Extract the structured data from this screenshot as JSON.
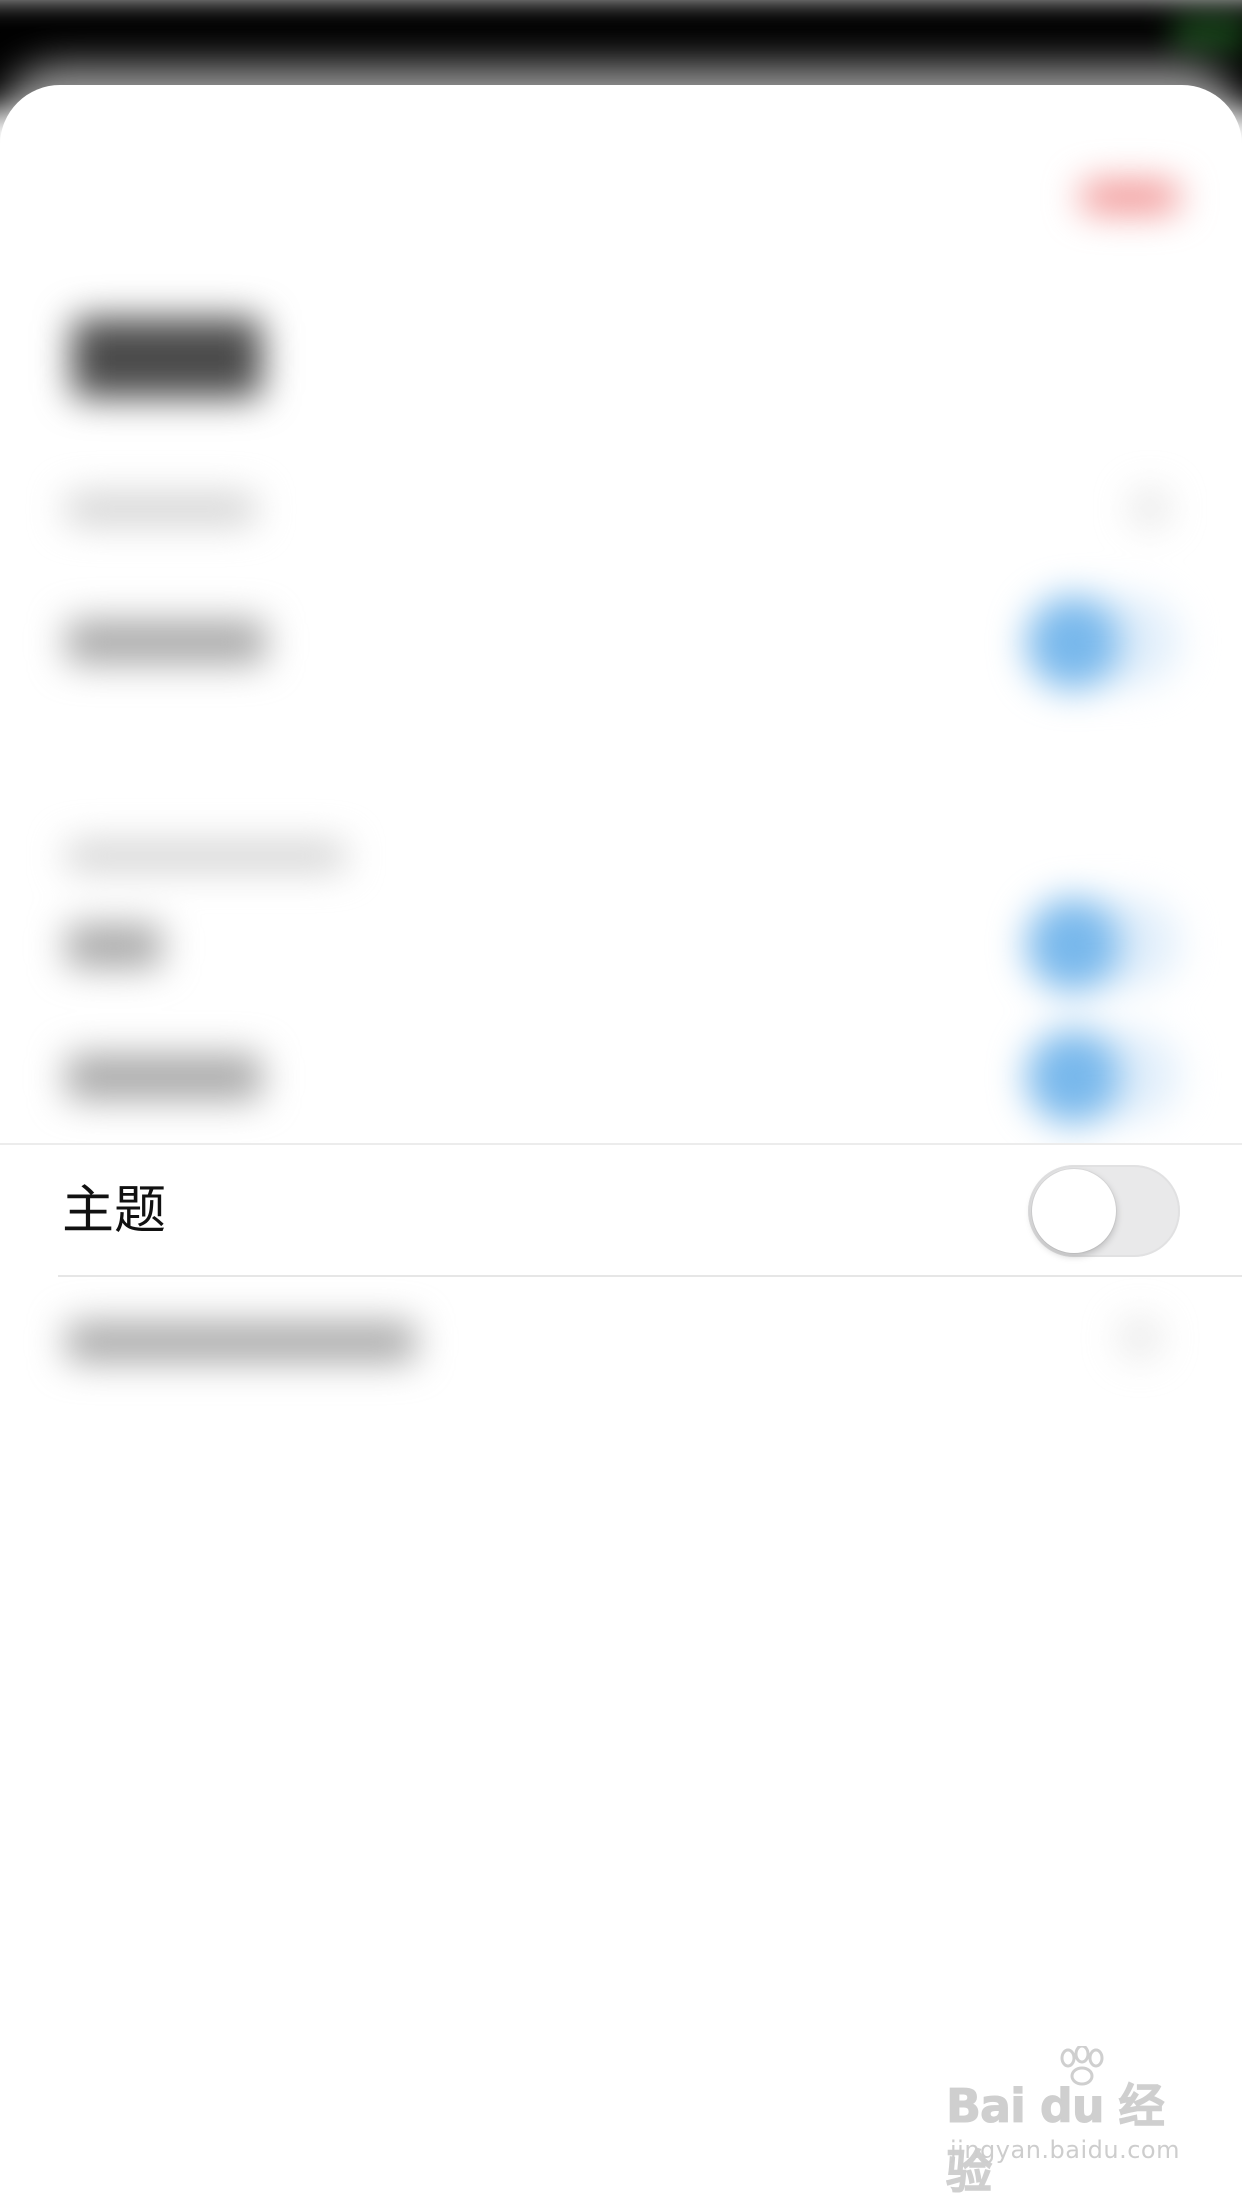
{
  "settings": {
    "focused_row": {
      "label": "主题",
      "toggle_on": false
    }
  },
  "colors": {
    "toggle_off_track": "#e9e9ea",
    "toggle_on_blurred": "#78b8ec",
    "accent_red_blurred": "#f08a8a"
  },
  "watermark": {
    "logo_text": "Bai du 经验",
    "url": "jingyan.baidu.com"
  }
}
